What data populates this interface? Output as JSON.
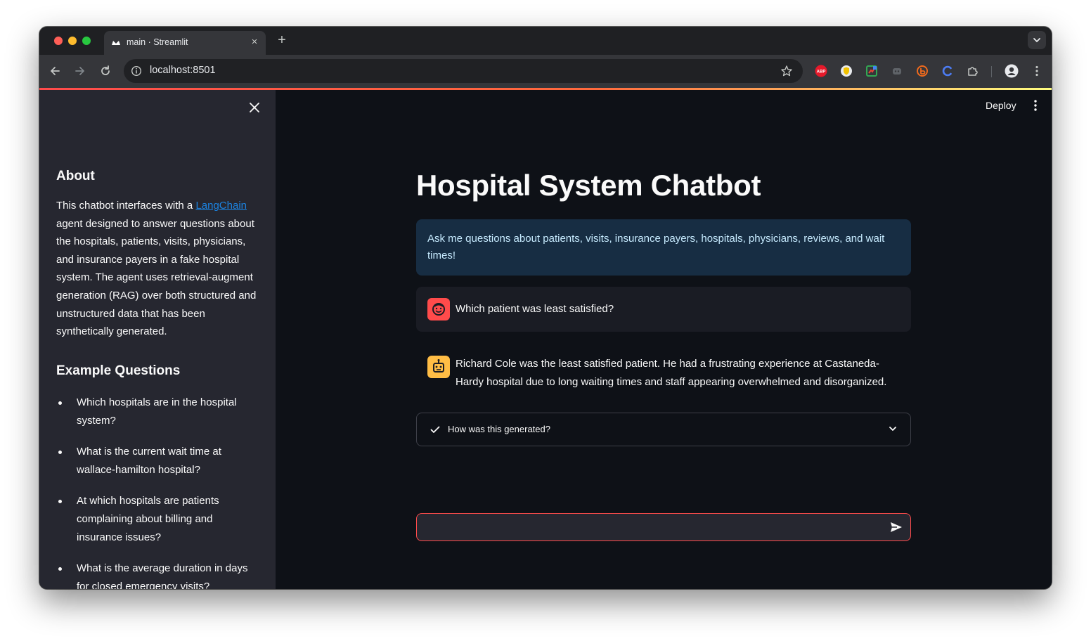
{
  "browser": {
    "tab_title": "main · Streamlit",
    "url": "localhost:8501",
    "new_tab_symbol": "+",
    "tab_close_symbol": "×"
  },
  "header": {
    "deploy_label": "Deploy"
  },
  "sidebar": {
    "about_heading": "About",
    "about_pre": "This chatbot interfaces with a ",
    "about_link": "LangChain",
    "about_post": " agent designed to answer questions about the hospitals, patients, visits, physicians, and insurance payers in a fake hospital system. The agent uses retrieval-augment generation (RAG) over both structured and unstructured data that has been synthetically generated.",
    "examples_heading": "Example Questions",
    "examples": [
      "Which hospitals are in the hospital system?",
      "What is the current wait time at wallace-hamilton hospital?",
      "At which hospitals are patients complaining about billing and insurance issues?",
      "What is the average duration in days for closed emergency visits?"
    ]
  },
  "main": {
    "title": "Hospital System Chatbot",
    "info": "Ask me questions about patients, visits, insurance payers, hospitals, physicians, reviews, and wait times!",
    "messages": [
      {
        "role": "user",
        "text": "Which patient was least satisfied?"
      },
      {
        "role": "assistant",
        "text": "Richard Cole was the least satisfied patient. He had a frustrating experience at Castaneda-Hardy hospital due to long waiting times and staff appearing overwhelmed and disorganized."
      }
    ],
    "expander_label": "How was this generated?",
    "chat_input_value": ""
  },
  "colors": {
    "accent": "#ff4b4b",
    "user_avatar": "#ff4b4b",
    "assistant_avatar": "#ffbd45",
    "info_bg": "#172d43",
    "link": "#1c83e1"
  }
}
